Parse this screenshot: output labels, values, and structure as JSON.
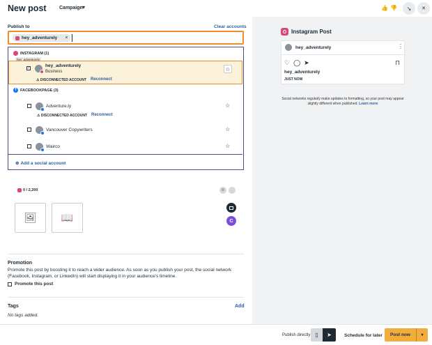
{
  "header": {
    "title": "New post",
    "campaign_label": "Campaign",
    "chevron": "▾",
    "thumbs_up": "👍",
    "thumbs_down": "👎",
    "minimize_glyph": "↘",
    "close_glyph": "✕"
  },
  "publish": {
    "label": "Publish to",
    "clear_label": "Clear accounts",
    "chip_label": "hey_adventurely",
    "chip_remove": "×"
  },
  "dropdown": {
    "instagram_group": "INSTAGRAM (1)",
    "tooltip": "hey_adventurely",
    "selected_account": {
      "name": "hey_adventurely",
      "type": "Business",
      "status": "⚠ DISCONNECTED ACCOUNT",
      "reconnect": "Reconnect",
      "checked": "✓"
    },
    "facebook_group": "FACEBOOKPAGE (3)",
    "facebook_glyph": "f",
    "accounts": [
      {
        "name": "Adventure.ly",
        "status": "⚠ DISCONNECTED ACCOUNT",
        "reconnect": "Reconnect"
      },
      {
        "name": "Vancouver Copywriters"
      },
      {
        "name": "Wairco"
      }
    ],
    "star": "☆",
    "star_selected": "☆",
    "add_social_icon": "⊕",
    "add_social": "Add a social account"
  },
  "composer": {
    "char_counter": "0 / 2,200",
    "image_icon": "🖼",
    "book_icon": "📖",
    "emoji_icon": "☺",
    "ai_letter": "C"
  },
  "promotion": {
    "title": "Promotion",
    "text": "Promote this post by boosting it to reach a wider audience. As soon as you publish your post, the social network (Facebook, Instagram, or LinkedIn) will start displaying it in your audience's timeline.",
    "checkbox_label": "Promote this post"
  },
  "tags": {
    "title": "Tags",
    "add_label": "Add",
    "empty_text": "No tags added."
  },
  "preview": {
    "title": "Instagram Post",
    "username": "hey_adventurely",
    "menu": "⋮",
    "like": "♡",
    "comment": "◯",
    "share": "➤",
    "bookmark": "⊓",
    "caption_user": "hey_adventurely",
    "time": "JUST NOW",
    "note": "Social networks regularly make updates to formatting, so your post may appear slightly different when published.",
    "learn_more": "Learn more"
  },
  "footer": {
    "publish_directly": "Publish directly",
    "phone_icon": "▯",
    "send_icon": "➤",
    "schedule": "Schedule for later",
    "post_now": "Post now",
    "post_menu": "▾"
  },
  "colors": {
    "accent_orange": "#ef8d2f",
    "post_button": "#f0ad3c",
    "link_blue": "#2e5f9e",
    "dropdown_border": "#4a4d85",
    "instagram": "#d6497a",
    "facebook": "#1877f2"
  }
}
